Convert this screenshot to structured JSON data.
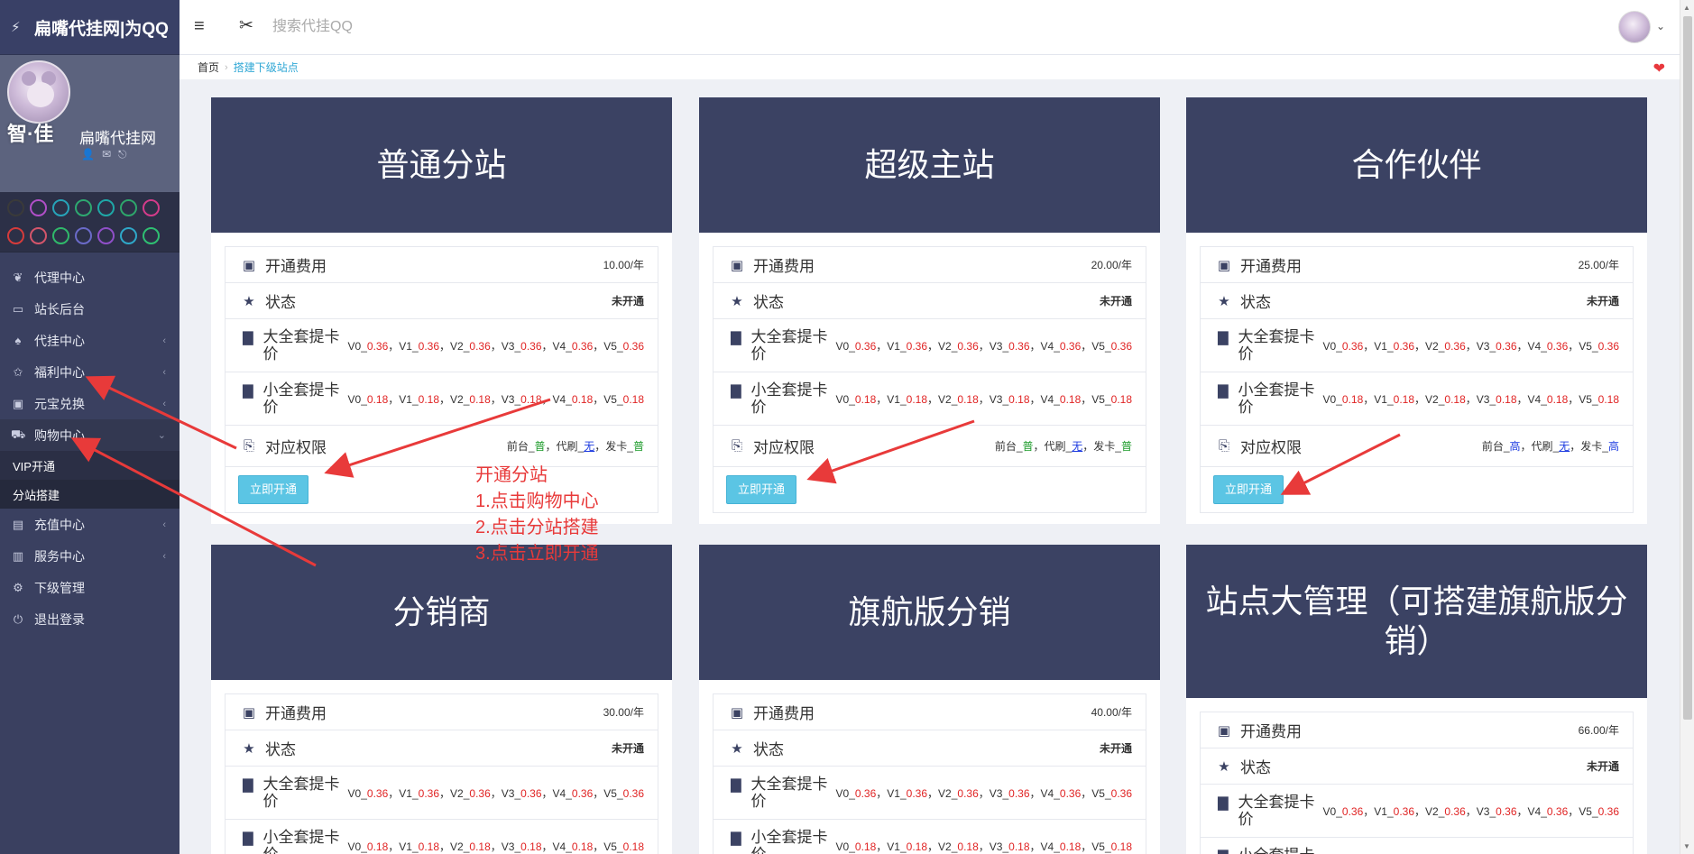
{
  "sidebar": {
    "brand": "扁嘴代挂网|为QQ",
    "greeting": "智·佳",
    "site_name": "扁嘴代挂网",
    "palette": [
      "#3a3a3a",
      "#b04fc7",
      "#27a3b8",
      "#2ea870",
      "#1fa7a7",
      "#2ea56b",
      "#d33b8a",
      "#d53b3b",
      "#d4556a",
      "#30b86a",
      "#6a6ac8",
      "#8f4fc8",
      "#2fa7c8",
      "#2fbf72"
    ],
    "nav": [
      {
        "icon": "leaf-icon",
        "glyph": "❦",
        "label": "代理中心",
        "chevron": false
      },
      {
        "icon": "monitor-icon",
        "glyph": "▭",
        "label": "站长后台",
        "chevron": false
      },
      {
        "icon": "bell-icon",
        "glyph": "♠",
        "label": "代挂中心",
        "chevron": true
      },
      {
        "icon": "star-icon",
        "glyph": "✩",
        "label": "福利中心",
        "chevron": true
      },
      {
        "icon": "money-icon",
        "glyph": "▣",
        "label": "元宝兑换",
        "chevron": true
      },
      {
        "icon": "cart-icon",
        "glyph": "⛟",
        "label": "购物中心",
        "chevron": true,
        "expanded": true
      },
      {
        "icon": "card-icon",
        "glyph": "▤",
        "label": "充值中心",
        "chevron": true
      },
      {
        "icon": "file-icon",
        "glyph": "▥",
        "label": "服务中心",
        "chevron": true
      },
      {
        "icon": "network-icon",
        "glyph": "⚙",
        "label": "下级管理",
        "chevron": false
      },
      {
        "icon": "power-icon",
        "glyph": "⏻",
        "label": "退出登录",
        "chevron": false
      }
    ],
    "subnav": [
      "VIP开通",
      "分站搭建"
    ]
  },
  "topbar": {
    "search_placeholder": "搜索代挂QQ"
  },
  "breadcrumb": {
    "home": "首页",
    "current": "搭建下级站点"
  },
  "labels": {
    "fee": "开通费用",
    "status": "状态",
    "big_price": "大全套提卡价",
    "small_price": "小全套提卡价",
    "permission": "对应权限",
    "button": "立即开通"
  },
  "price_levels": [
    "V0",
    "V1",
    "V2",
    "V3",
    "V4",
    "V5"
  ],
  "big_value": "0.36",
  "small_value": "0.18",
  "perm_words": {
    "front": "前台",
    "proxy": "代刷",
    "card": "发卡"
  },
  "cards": [
    {
      "title": "普通分站",
      "fee": "10.00/年",
      "status": "未开通",
      "perm": {
        "front": "普",
        "proxy": "无",
        "card": "普"
      }
    },
    {
      "title": "超级主站",
      "fee": "20.00/年",
      "status": "未开通",
      "perm": {
        "front": "普",
        "proxy": "无",
        "card": "普"
      }
    },
    {
      "title": "合作伙伴",
      "fee": "25.00/年",
      "status": "未开通",
      "perm": {
        "front": "高",
        "proxy": "无",
        "card": "高"
      }
    },
    {
      "title": "分销商",
      "fee": "30.00/年",
      "status": "未开通"
    },
    {
      "title": "旗航版分销",
      "fee": "40.00/年",
      "status": "未开通"
    },
    {
      "title": "站点大管理（可搭建旗航版分销）",
      "fee": "66.00/年",
      "status": "未开通"
    }
  ],
  "annotation": {
    "lines": [
      "开通分站",
      "1.点击购物中心",
      "2.点击分站搭建",
      "3.点击立即开通"
    ],
    "color": "#e83a3a"
  }
}
